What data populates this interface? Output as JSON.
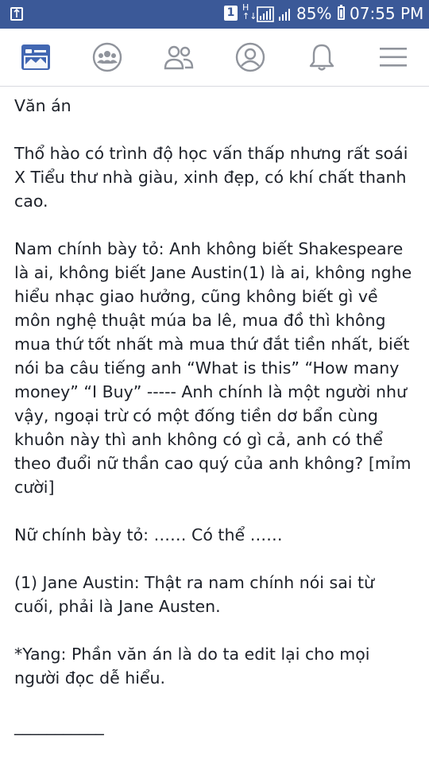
{
  "status_bar": {
    "battery_text": "85%",
    "time": "07:55 PM",
    "icons": [
      "recycle-icon",
      "notification-one-icon",
      "h-network-icon",
      "signal-icon",
      "signal-icon",
      "battery-icon"
    ],
    "indicator_one": "1",
    "network_letter": "H"
  },
  "nav": {
    "items": [
      {
        "name": "news-feed-icon",
        "active": true
      },
      {
        "name": "groups-icon",
        "active": false
      },
      {
        "name": "friends-icon",
        "active": false
      },
      {
        "name": "profile-icon",
        "active": false
      },
      {
        "name": "notifications-icon",
        "active": false
      },
      {
        "name": "menu-icon",
        "active": false
      }
    ],
    "active_color": "#4267b2",
    "inactive_color": "#90949c"
  },
  "post": {
    "p1": "Văn án",
    "p2": "Thổ hào có trình độ học vấn thấp nhưng rất soái X Tiểu thư nhà giàu, xinh đẹp, có khí chất thanh cao.",
    "p3": "Nam chính bày tỏ: Anh không biết Shakespeare là ai, không biết Jane Austin(1) là ai, không nghe hiểu nhạc giao hưởng, cũng không biết gì về môn nghệ thuật múa ba lê, mua đồ thì không mua thứ tốt nhất mà mua thứ đắt tiền nhất, biết nói ba câu tiếng anh “What is this” “How many money” “I Buy” ----- Anh chính là một người như vậy, ngoại trừ có một đống tiền dơ bẩn cùng khuôn này thì anh không có gì cả, anh có thể theo đuổi nữ thần cao quý của anh không? [mỉm cười]",
    "p4": "Nữ chính bày tỏ: …… Có thể ……",
    "p5": "(1) Jane Austin: Thật ra nam chính nói sai từ cuối, phải là Jane Austen.",
    "p6": "*Yang: Phần văn án là do ta edit lại cho mọi người đọc dễ hiểu.",
    "p7": "___________"
  }
}
